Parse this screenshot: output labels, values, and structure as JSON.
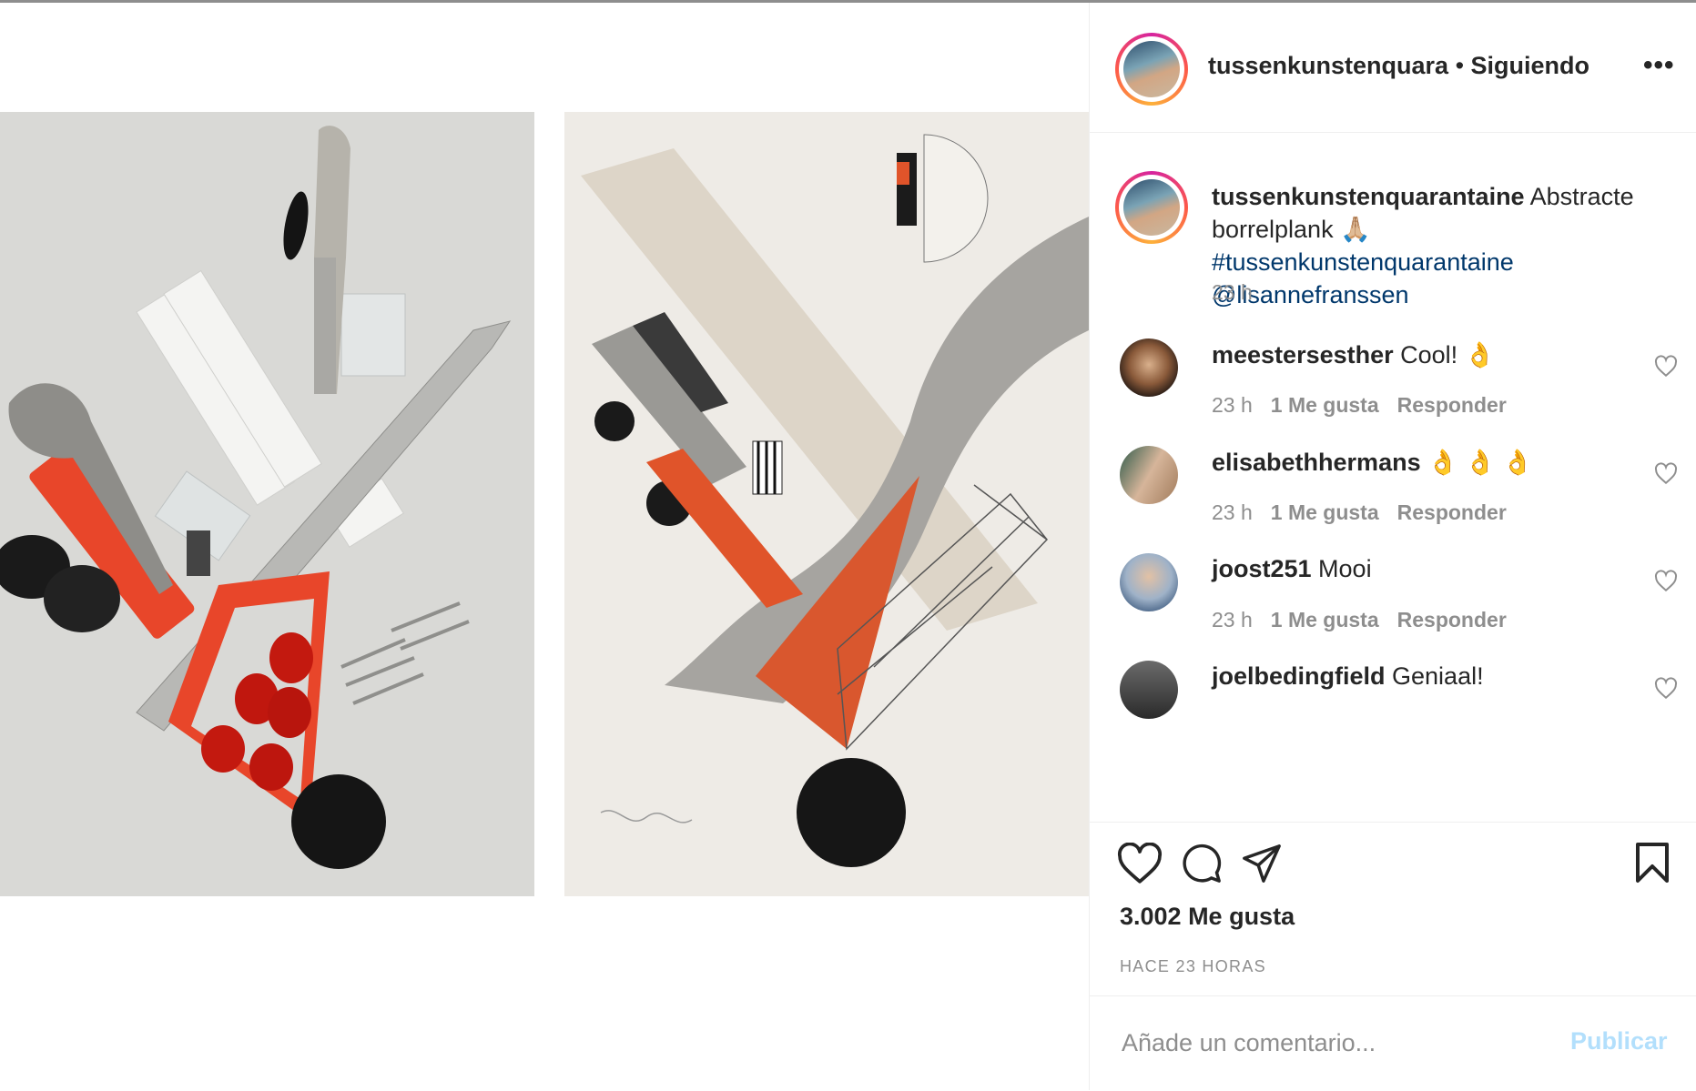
{
  "post": {
    "author": "tussenkunstenquara",
    "separator": " • ",
    "follow_status": "Siguiendo",
    "more_label": "•••"
  },
  "caption": {
    "author": "tussenkunstenquarantaine",
    "text": " Abstracte borrelplank 🙏🏼",
    "hashtag": "#tussenkunstenquarantaine",
    "mention": "@lisannefranssen",
    "time": "23 h"
  },
  "comments": [
    {
      "user": "meestersesther",
      "text": " Cool! 👌",
      "time": "23 h",
      "likes": "1 Me gusta",
      "reply": "Responder"
    },
    {
      "user": "elisabethhermans",
      "text": " 👌 👌 👌",
      "time": "23 h",
      "likes": "1 Me gusta",
      "reply": "Responder"
    },
    {
      "user": "joost251",
      "text": " Mooi",
      "time": "23 h",
      "likes": "1 Me gusta",
      "reply": "Responder"
    },
    {
      "user": "joelbedingfield",
      "text": " Geniaal!",
      "time": "",
      "likes": "",
      "reply": ""
    }
  ],
  "stats": {
    "likes": "3.002 Me gusta",
    "ago": "HACE 23 HORAS"
  },
  "add_comment": {
    "placeholder": "Añade un comentario...",
    "publish": "Publicar"
  },
  "colors": {
    "accent_orange": "#e0542a",
    "link_blue": "#00376b",
    "publish_disabled": "#b2dffc",
    "muted": "#8e8e8e"
  },
  "icons": [
    "heart-icon",
    "comment-icon",
    "share-icon",
    "bookmark-icon",
    "more-icon",
    "small-heart-icon"
  ]
}
